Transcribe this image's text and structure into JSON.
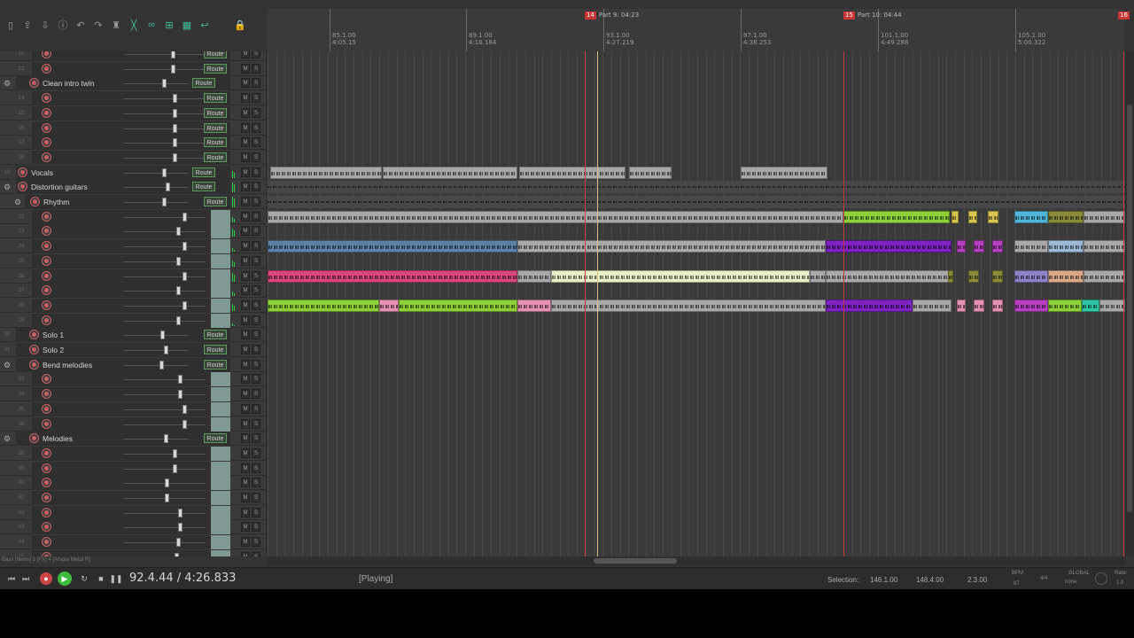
{
  "toolbar": {
    "icons": [
      "new-project-icon",
      "open-icon",
      "save-icon",
      "info-icon",
      "undo-icon",
      "redo-icon",
      "metronome-icon",
      "snap-icon",
      "ripple-icon",
      "lock-grouping-icon",
      "grid-icon",
      "loop-icon",
      "lock-icon"
    ]
  },
  "ruler": {
    "marks": [
      {
        "bar": "85.1.00",
        "time": "4:05.15"
      },
      {
        "bar": "89.1.00",
        "time": "4:16.184"
      },
      {
        "bar": "93.1.00",
        "time": "4:27.219"
      },
      {
        "bar": "97.1.00",
        "time": "4:38.253"
      },
      {
        "bar": "101.1.00",
        "time": "4:49.288"
      },
      {
        "bar": "105.1.00",
        "time": "5:00.322"
      }
    ],
    "regions": [
      {
        "num": "14",
        "label": "Part 9: 04:23"
      },
      {
        "num": "15",
        "label": "Part 10: 04:44"
      },
      {
        "num": "16",
        "label": ""
      }
    ]
  },
  "tracks": [
    {
      "num": "11",
      "name": "",
      "route": "Route",
      "fader": 0.58
    },
    {
      "num": "12",
      "name": "",
      "route": "Route",
      "fader": 0.58
    },
    {
      "num": "13",
      "name": "Clean intro twin",
      "route": "Route",
      "fader": 0.6
    },
    {
      "num": "14",
      "name": "",
      "route": "Route",
      "fader": 0.6
    },
    {
      "num": "15",
      "name": "",
      "route": "Route",
      "fader": 0.6
    },
    {
      "num": "16",
      "name": "",
      "route": "Route",
      "fader": 0.6
    },
    {
      "num": "17",
      "name": "",
      "route": "Route",
      "fader": 0.6
    },
    {
      "num": "18",
      "name": "",
      "route": "Route",
      "fader": 0.6
    },
    {
      "num": "19",
      "name": "Vocals",
      "route": "Route",
      "fader": 0.6
    },
    {
      "num": "20",
      "name": "Distortion guitars",
      "route": "Route",
      "fader": 0.65
    },
    {
      "num": "21",
      "name": "Rhythm",
      "route": "Route",
      "fader": 0.6
    },
    {
      "num": "22",
      "name": "",
      "route": "",
      "fader": 0.72
    },
    {
      "num": "23",
      "name": "",
      "route": "",
      "fader": 0.64
    },
    {
      "num": "24",
      "name": "",
      "route": "",
      "fader": 0.72
    },
    {
      "num": "25",
      "name": "",
      "route": "",
      "fader": 0.64
    },
    {
      "num": "26",
      "name": "",
      "route": "",
      "fader": 0.72
    },
    {
      "num": "27",
      "name": "",
      "route": "",
      "fader": 0.64
    },
    {
      "num": "28",
      "name": "",
      "route": "",
      "fader": 0.72
    },
    {
      "num": "29",
      "name": "",
      "route": "",
      "fader": 0.64
    },
    {
      "num": "30",
      "name": "Solo 1",
      "route": "Route",
      "fader": 0.57
    },
    {
      "num": "31",
      "name": "Solo 2",
      "route": "Route",
      "fader": 0.62
    },
    {
      "num": "32",
      "name": "Bend melodies",
      "route": "Route",
      "fader": 0.55
    },
    {
      "num": "33",
      "name": "",
      "route": "",
      "fader": 0.66
    },
    {
      "num": "34",
      "name": "",
      "route": "",
      "fader": 0.66
    },
    {
      "num": "35",
      "name": "",
      "route": "",
      "fader": 0.72
    },
    {
      "num": "36",
      "name": "",
      "route": "",
      "fader": 0.72
    },
    {
      "num": "37",
      "name": "Melodies",
      "route": "Route",
      "fader": 0.62
    },
    {
      "num": "38",
      "name": "",
      "route": "",
      "fader": 0.6
    },
    {
      "num": "39",
      "name": "",
      "route": "",
      "fader": 0.6
    },
    {
      "num": "40",
      "name": "",
      "route": "",
      "fader": 0.5
    },
    {
      "num": "41",
      "name": "",
      "route": "",
      "fader": 0.5
    },
    {
      "num": "42",
      "name": "",
      "route": "",
      "fader": 0.66
    },
    {
      "num": "43",
      "name": "",
      "route": "",
      "fader": 0.66
    },
    {
      "num": "44",
      "name": "",
      "route": "",
      "fader": 0.64
    },
    {
      "num": "45",
      "name": "",
      "route": "",
      "fader": 0.62
    }
  ],
  "hint": "Bass [Items] 1 [FX] 4 [Ampla Metal R]",
  "transport": {
    "position": "92.4.44 / 4:26.833",
    "state": "[Playing]",
    "selection_label": "Selection:",
    "sel_start": "146.1.00",
    "sel_end": "148.4.00",
    "sel_len": "2.3.00",
    "bpm_label": "BPM",
    "bpm": "87",
    "timesig": "4/4",
    "global_label": "GLOBAL",
    "global_val": "none",
    "rate_label": "Rate:",
    "rate_val": "1.0"
  },
  "colors": {
    "gray": "#a8a8a8",
    "blue": "#5d82a8",
    "pink": "#d8467e",
    "lightpink": "#e690b5",
    "lime": "#8cd13a",
    "cream": "#e9f0c8",
    "purple": "#7e22c4",
    "yellow": "#d9c64e",
    "cyan": "#4fb6d8",
    "peach": "#d8a887",
    "teal": "#2fc6a7",
    "olive": "#8a8a3a",
    "lavender": "#8f82c8",
    "magenta": "#b53fbf",
    "lightblue": "#9bb9d6"
  }
}
